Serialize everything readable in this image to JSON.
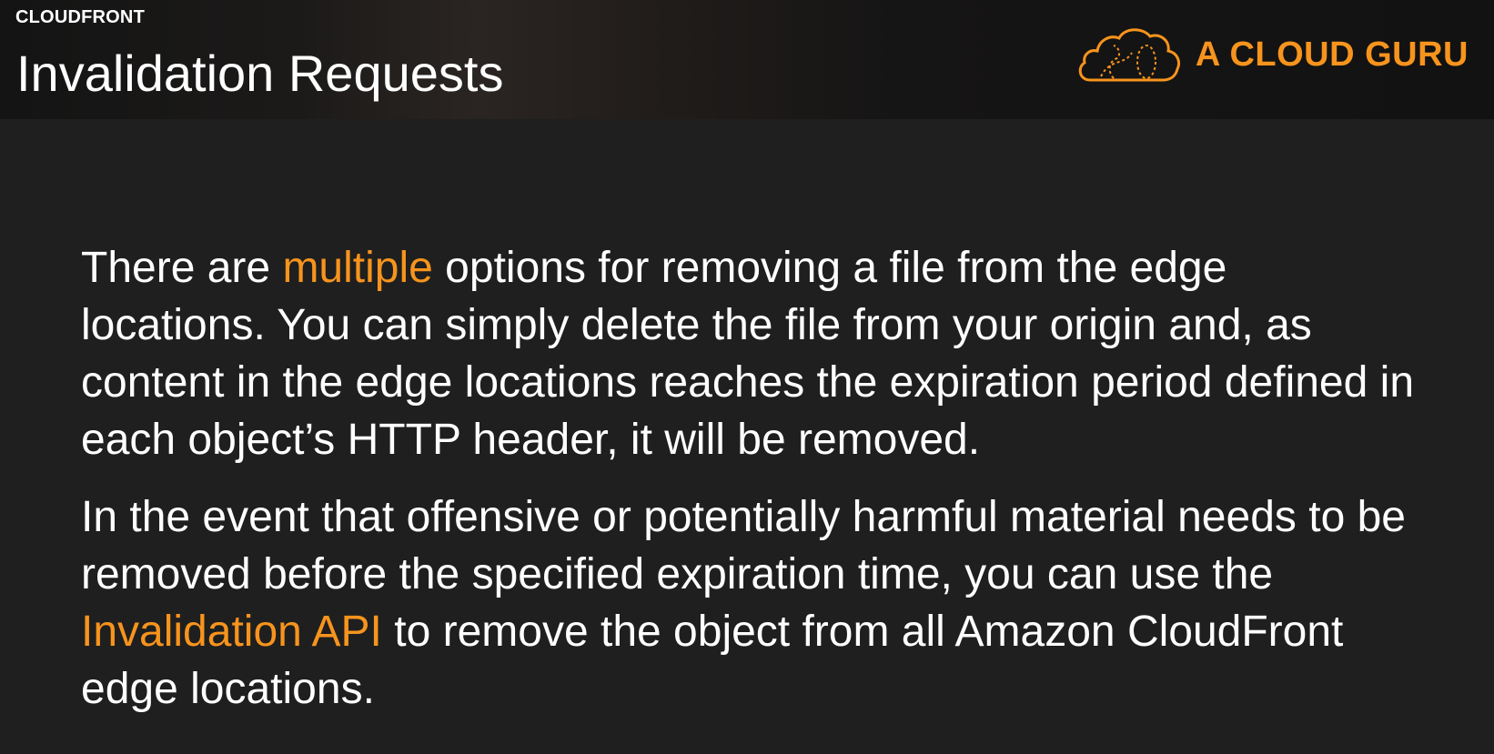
{
  "header": {
    "kicker": "CLOUDFRONT",
    "title": "Invalidation Requests",
    "brand": {
      "logo_icon": "cloud-logo-icon",
      "name": "A CLOUD GURU",
      "accent_color": "#f7941d"
    }
  },
  "body": {
    "paragraph1": {
      "before": "There are ",
      "highlight": "multiple",
      "after": " options for removing a file from the edge locations. You can simply delete the file from your origin and, as content in the edge locations reaches the expiration period defined in each object’s HTTP header, it will be removed."
    },
    "paragraph2": {
      "before": "In the event that offensive or potentially harmful material needs to be removed before the specified expiration time, you can use the ",
      "highlight": "Invalidation API",
      "after": " to remove the object from all Amazon CloudFront edge locations."
    }
  }
}
